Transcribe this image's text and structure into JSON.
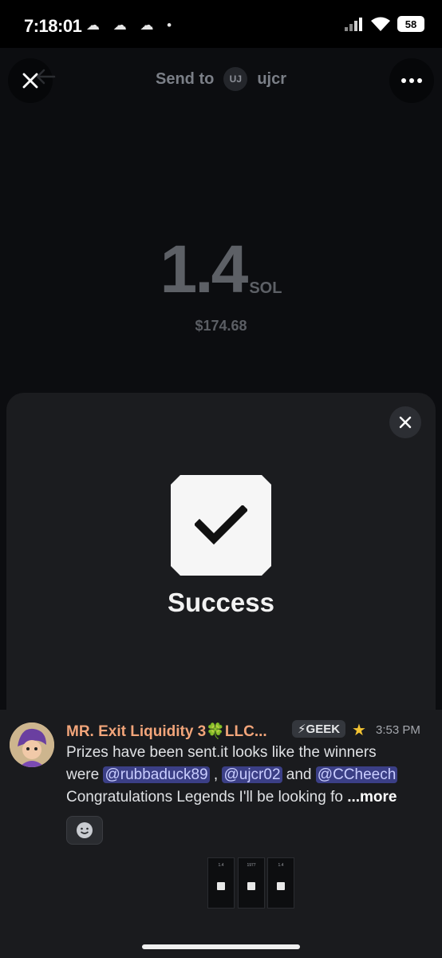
{
  "status_bar": {
    "time": "7:18:01",
    "notif_icons": "☁ ☁ ☁ •",
    "battery": "58"
  },
  "header": {
    "send_to_label": "Send to",
    "recipient_initials": "UJ",
    "recipient_name": "ujcr"
  },
  "transfer": {
    "amount": "1.4",
    "unit": "SOL",
    "usd_value": "$174.68"
  },
  "success_sheet": {
    "title": "Success"
  },
  "message": {
    "author": "MR. Exit Liquidity 3🍀LLC...",
    "badge": "⚡GEEK",
    "time": "3:53 PM",
    "line1": "Prizes have been sent.it  looks like the winners",
    "line2_prefix": "were ",
    "mention1": "@rubbaduck89",
    "line2_sep1": " , ",
    "mention2": "@ujcr02",
    "line2_sep2": " and ",
    "mention3": "@CCheech",
    "line3": "Congratulations Legends I'll be looking fo ",
    "more": "...more"
  },
  "attachments": [
    {
      "caption": "1.4"
    },
    {
      "caption": "1977"
    },
    {
      "caption": "1.4"
    }
  ],
  "colors": {
    "author": "#f2a57a",
    "mention_bg": "#3b3f86",
    "sheet_bg": "#1b1c1f"
  },
  "icons": [
    "close-icon",
    "back-arrow-icon",
    "more-icon",
    "check-icon",
    "emoji-icon",
    "star-icon"
  ]
}
